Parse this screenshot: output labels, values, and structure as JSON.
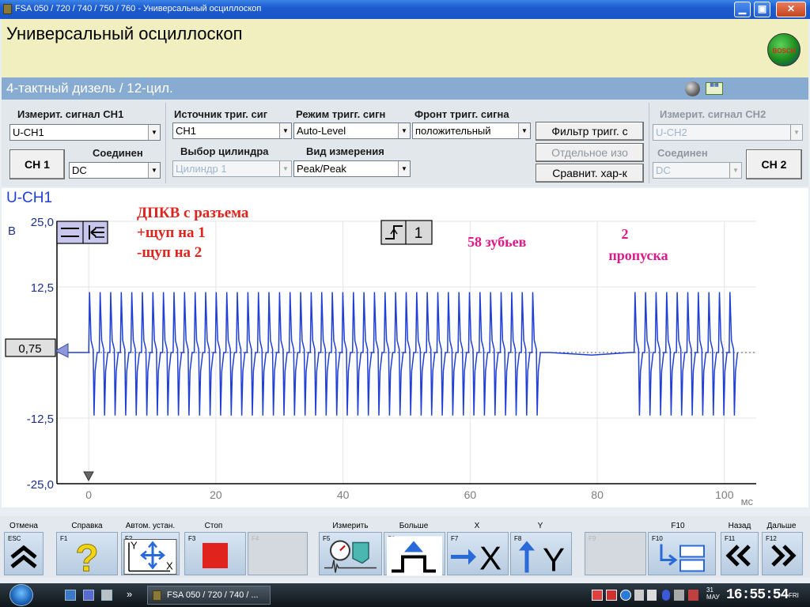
{
  "window": {
    "title": "FSA 050 / 720 / 740 / 750 / 760 - Универсальный осциллоскоп",
    "minimize": "▁",
    "maximize": "▣",
    "close": "✕"
  },
  "header": {
    "title": "Универсальный осциллоскоп",
    "logo_text": "BOSCH",
    "subtitle": "4-тактный дизель / 12-цил."
  },
  "ch1": {
    "label": "Измерит. сигнал CH1",
    "signal": "U-CH1",
    "button": "CH 1",
    "coupling_label": "Соединен",
    "coupling": "DC"
  },
  "trigger": {
    "source_label": "Источник триг. сиг",
    "source": "CH1",
    "mode_label": "Режим тригг. сигн",
    "mode": "Auto-Level",
    "edge_label": "Фронт тригг. сигна",
    "edge": "положительный",
    "filter_button": "Фильтр тригг. с",
    "cylinder_label": "Выбор цилиндра",
    "cylinder": "Цилиндр 1",
    "measure_label": "Вид измерения",
    "measure": "Peak/Peak",
    "separate_button": "Отдельное изо",
    "compare_button": "Сравнит. хар-к"
  },
  "ch2": {
    "label": "Измерит. сигнал CH2",
    "signal": "U-CH2",
    "coupling_label": "Соединен",
    "coupling": "DC",
    "button": "CH 2"
  },
  "scope": {
    "channel": "U-CH1",
    "trigger_level": "0,75",
    "trigger_channel": "1",
    "annotations": {
      "source_note": [
        "ДПКВ с разъема",
        "+щуп на 1",
        "-щуп на 2"
      ],
      "teeth": "58 зубьев",
      "gap_count": "2",
      "gap_label": "пропуска"
    },
    "colors": {
      "trace": "#1f3fd6",
      "notes_red": "#e0241d",
      "notes_pink": "#e0198a"
    }
  },
  "chart_data": {
    "type": "line",
    "xlabel": "мс",
    "ylabel": "В",
    "xlim": [
      -5,
      105
    ],
    "ylim": [
      -25,
      25
    ],
    "x_ticks": [
      "0",
      "20",
      "40",
      "60",
      "80",
      "100"
    ],
    "y_ticks": [
      "25,0",
      "12,5",
      "-12,5",
      "-25,0"
    ],
    "series": [
      {
        "name": "U-CH1",
        "waveform": "crankshaft_sensor_teeth",
        "amplitude_peak": 11.5,
        "amplitude_trough": -12.0,
        "baseline": 0.0,
        "first_tooth_ms": 0.0,
        "tooth_period_ms": 1.66,
        "teeth_before_gap": 43,
        "gap_start_ms": 72.5,
        "gap_end_ms": 85.8,
        "end_ms": 103
      }
    ]
  },
  "fkeys": [
    {
      "label": "Отмена",
      "num": "ESC",
      "icon": "double-chevron-up-icon",
      "enabled": true
    },
    {
      "label": "Справка",
      "num": "F1",
      "icon": "help-question-icon",
      "enabled": true
    },
    {
      "label": "Автом. устан.",
      "num": "F2",
      "icon": "auto-setup-icon",
      "enabled": true
    },
    {
      "label": "Стоп",
      "num": "F3",
      "icon": "stop-icon",
      "enabled": true
    },
    {
      "label": "",
      "num": "F4",
      "icon": "",
      "enabled": false
    },
    {
      "label": "Измерить",
      "num": "F5",
      "icon": "measure-icon",
      "enabled": true
    },
    {
      "label": "Больше",
      "num": "F6",
      "icon": "more-icon",
      "enabled": true
    },
    {
      "label": "X",
      "num": "F7",
      "icon": "x-axis-icon",
      "enabled": true
    },
    {
      "label": "Y",
      "num": "F8",
      "icon": "y-axis-icon",
      "enabled": true
    },
    {
      "label": "",
      "num": "F9",
      "icon": "",
      "enabled": false
    },
    {
      "label": "F10",
      "num": "F10",
      "icon": "layout-icon",
      "enabled": true
    },
    {
      "label": "Назад",
      "num": "F11",
      "icon": "double-chevron-left-icon",
      "enabled": true
    },
    {
      "label": "Дальше",
      "num": "F12",
      "icon": "double-chevron-right-icon",
      "enabled": true
    }
  ],
  "taskbar": {
    "app_button": "FSA 050 / 720 / 740 / ...",
    "more": "»",
    "date_day": "31",
    "date_month": "МАУ",
    "time": "16:55:54",
    "weekday": "FRI"
  }
}
